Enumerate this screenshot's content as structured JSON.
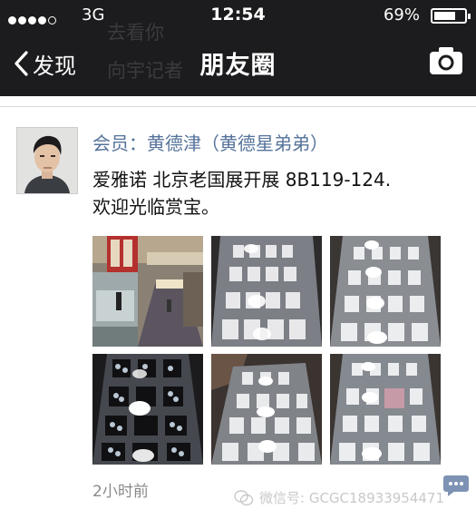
{
  "status_bar": {
    "signal_dots": 5,
    "signal_filled": 4,
    "network": "3G",
    "time": "12:54",
    "battery_percent": "69%",
    "battery_level": 0.69
  },
  "nav": {
    "back_label": "发现",
    "title": "朋友圈"
  },
  "background_text": {
    "line1": "去看你",
    "line2": "向宇记者"
  },
  "post": {
    "author": "会员：黄德津（黄德星弟弟）",
    "text_line1": "爱雅诺 北京老国展开展 8B119-124.",
    "text_line2": "欢迎光临赏宝。",
    "photos": [
      {
        "name": "exhibition-hall-photo"
      },
      {
        "name": "display-case-photo"
      },
      {
        "name": "display-case-photo"
      },
      {
        "name": "gem-tray-photo"
      },
      {
        "name": "display-case-photo"
      },
      {
        "name": "display-case-photo"
      }
    ],
    "time": "2小时前"
  },
  "watermark": "微信号: GCGC18933954471",
  "icons": {
    "back": "chevron-left-icon",
    "camera": "camera-icon",
    "comment": "comment-icon"
  },
  "colors": {
    "bar": "#1c1c1e",
    "author": "#55739a",
    "time": "#8a8a8a",
    "comment_btn": "#7e93b4"
  }
}
